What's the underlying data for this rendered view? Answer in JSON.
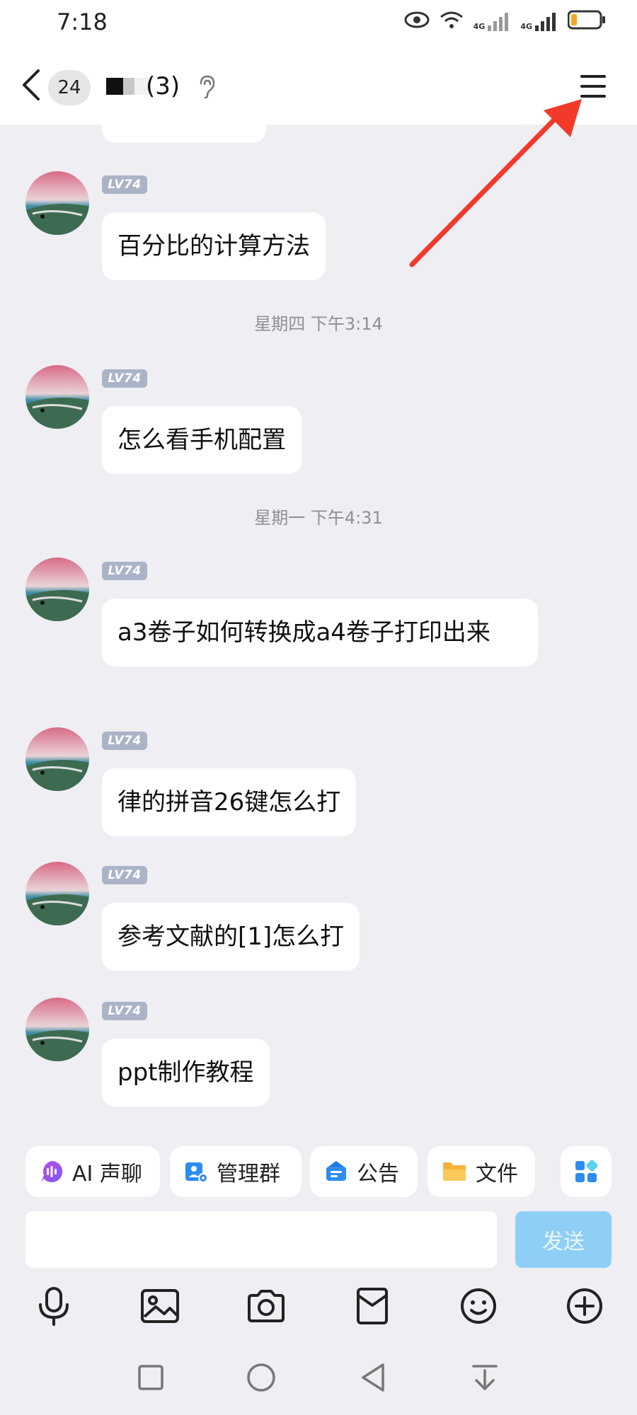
{
  "status": {
    "time": "7:18",
    "network_1": "4G",
    "network_2": "4G",
    "icons": [
      "eye-icon",
      "wifi-icon",
      "signal-icon",
      "signal-icon",
      "battery-icon"
    ]
  },
  "header": {
    "unread_count": "24",
    "title_visible": "(3)",
    "icons": [
      "back-icon",
      "ear-icon",
      "menu-icon"
    ]
  },
  "messages": [
    {
      "level": "LV74",
      "text": "百分比的计算方法"
    },
    {
      "timestamp": "星期四 下午3:14"
    },
    {
      "level": "LV74",
      "text": "怎么看手机配置"
    },
    {
      "timestamp": "星期一 下午4:31"
    },
    {
      "level": "LV74",
      "text": "a3卷子如何转换成a4卷子打印出来"
    },
    {
      "level": "LV74",
      "text": "律的拼音26键怎么打"
    },
    {
      "level": "LV74",
      "text": "参考文献的[1]怎么打"
    },
    {
      "level": "LV74",
      "text": "ppt制作教程"
    }
  ],
  "quick_actions": [
    {
      "label": "AI 声聊",
      "icon": "ai-voice-icon"
    },
    {
      "label": "管理群",
      "icon": "manage-group-icon"
    },
    {
      "label": "公告",
      "icon": "announcement-icon"
    },
    {
      "label": "文件",
      "icon": "folder-icon"
    }
  ],
  "quick_more_icon": "apps-icon",
  "input": {
    "placeholder": "",
    "send_label": "发送"
  },
  "toolbar_icons": [
    "microphone-icon",
    "image-icon",
    "camera-icon",
    "red-packet-icon",
    "emoji-icon",
    "plus-icon"
  ],
  "nav_icons": [
    "recents-icon",
    "home-icon",
    "back-nav-icon",
    "notification-pull-icon"
  ],
  "colors": {
    "accent": "#8fcff6",
    "annotation_arrow": "#f23a2a",
    "level_badge": "#aab3c8"
  }
}
